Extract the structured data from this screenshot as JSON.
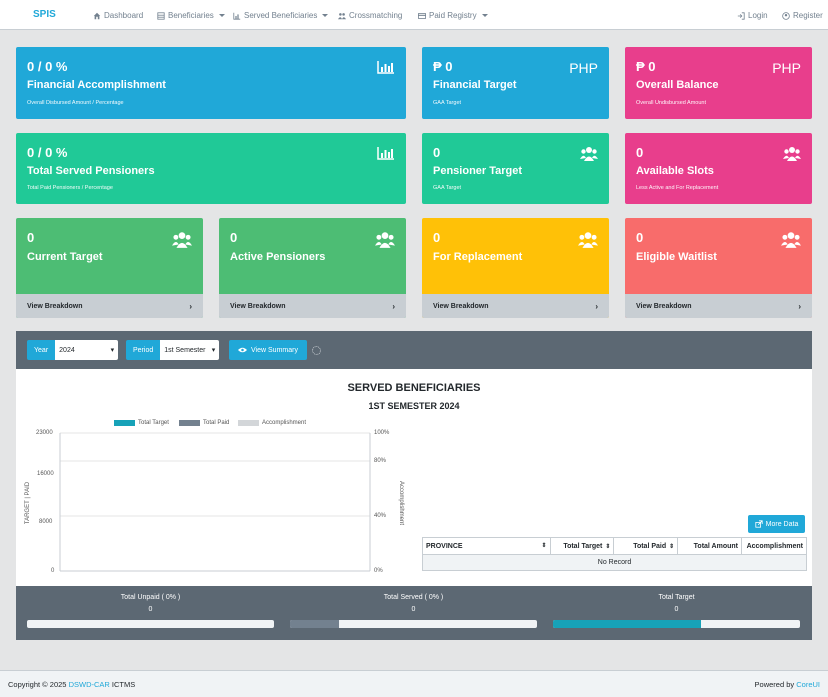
{
  "nav": {
    "brand": "SPIS",
    "items": [
      {
        "label": "Dashboard",
        "icon": "home-icon"
      },
      {
        "label": "Beneficiaries",
        "icon": "list-icon",
        "dropdown": true
      },
      {
        "label": "Served Beneficiaries",
        "icon": "bar-chart-icon",
        "dropdown": true
      },
      {
        "label": "Crossmatching",
        "icon": "users-icon"
      },
      {
        "label": "Paid Registry",
        "icon": "credit-card-icon",
        "dropdown": true
      }
    ],
    "login": "Login",
    "register": "Register"
  },
  "cards": {
    "financial_accomplishment": {
      "value": "0 / 0 %",
      "title": "Financial Accomplishment",
      "sub": "Overall Disbursed Amount / Percentage"
    },
    "financial_target": {
      "value": "₱ 0",
      "title": "Financial Target",
      "sub": "GAA Target",
      "unit": "PHP"
    },
    "overall_balance": {
      "value": "₱ 0",
      "title": "Overall Balance",
      "sub": "Overall Undisbursed Amount",
      "unit": "PHP"
    },
    "total_served": {
      "value": "0 / 0 %",
      "title": "Total Served Pensioners",
      "sub": "Total Paid Pensioners / Percentage"
    },
    "pensioner_target": {
      "value": "0",
      "title": "Pensioner Target",
      "sub": "GAA Target"
    },
    "available_slots": {
      "value": "0",
      "title": "Available Slots",
      "sub": "Less Active and For Replacement"
    },
    "current_target": {
      "value": "0",
      "title": "Current Target",
      "footer": "View Breakdown"
    },
    "active_pensioners": {
      "value": "0",
      "title": "Active Pensioners",
      "footer": "View Breakdown"
    },
    "for_replacement": {
      "value": "0",
      "title": "For Replacement",
      "footer": "View Breakdown"
    },
    "eligible_waitlist": {
      "value": "0",
      "title": "Eligible Waitlist",
      "footer": "View Breakdown"
    }
  },
  "filters": {
    "year_label": "Year",
    "year_value": "2024",
    "period_label": "Period",
    "period_value": "1st Semester",
    "view_summary": "View Summary"
  },
  "chart_data": {
    "type": "bar",
    "title": "SERVED BENEFICIARIES",
    "subtitle": "1ST SEMESTER 2024",
    "series": [
      {
        "name": "Total Target",
        "values": [],
        "color": "#17a2b8"
      },
      {
        "name": "Total Paid",
        "values": [],
        "color": "#73818f"
      },
      {
        "name": "Accomplishment",
        "values": [],
        "color": "#c8ced3"
      }
    ],
    "categories": [],
    "ylabel": "TARGET | PAID",
    "y2label": "Accomplishment",
    "yticks": [
      "23000",
      "16000",
      "8000",
      "0"
    ],
    "y2ticks": [
      "100%",
      "80%",
      "40%",
      "0%"
    ],
    "ylim": [
      0,
      23000
    ],
    "y2lim": [
      0,
      100
    ],
    "grid": true,
    "legend": "top"
  },
  "table": {
    "more_data": "More Data",
    "columns": [
      "PROVINCE",
      "Total Target",
      "Total Paid",
      "Total Amount",
      "Accomplishment"
    ],
    "empty": "No Record"
  },
  "summary": {
    "unpaid": {
      "label": "Total Unpaid ( 0% )",
      "value": "0",
      "progress": 0
    },
    "served": {
      "label": "Total Served ( 0% )",
      "value": "0",
      "progress": 0.2
    },
    "target": {
      "label": "Total Target",
      "value": "0",
      "progress": 0.6
    }
  },
  "footer": {
    "copyright": "Copyright © 2025",
    "org": "DSWD-CAR",
    "unit": "ICTMS",
    "powered": "Powered by",
    "powered_link": "CoreUI"
  },
  "colors": {
    "blue": "#20a8d8",
    "pink": "#e83e8c",
    "teal": "#20c997",
    "green": "#4dbd74",
    "yellow": "#ffc107",
    "red": "#f86c6b"
  }
}
